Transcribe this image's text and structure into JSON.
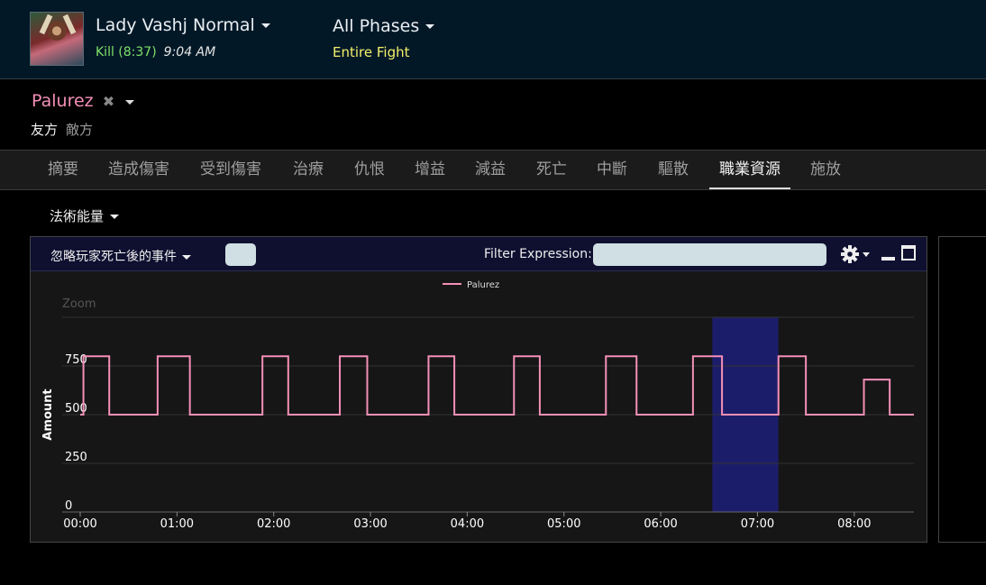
{
  "boss": {
    "name": "Lady Vashj Normal",
    "result": "Kill (8:37)",
    "time": "9:04 AM"
  },
  "phase": {
    "name": "All Phases",
    "subtitle": "Entire Fight"
  },
  "player": {
    "name": "Palurez",
    "remove_glyph": "✖",
    "ally_label": "友方",
    "enemy_label": "敵方"
  },
  "tabs": [
    {
      "label": "摘要",
      "active": false
    },
    {
      "label": "造成傷害",
      "active": false
    },
    {
      "label": "受到傷害",
      "active": false
    },
    {
      "label": "治療",
      "active": false
    },
    {
      "label": "仇恨",
      "active": false
    },
    {
      "label": "增益",
      "active": false
    },
    {
      "label": "減益",
      "active": false
    },
    {
      "label": "死亡",
      "active": false
    },
    {
      "label": "中斷",
      "active": false
    },
    {
      "label": "驅散",
      "active": false
    },
    {
      "label": "職業資源",
      "active": true
    },
    {
      "label": "施放",
      "active": false
    }
  ],
  "resource_type": "法術能量",
  "panel": {
    "ignore_label": "忽略玩家死亡後的事件",
    "filter_label": "Filter Expression:",
    "filter_value": ""
  },
  "colors": {
    "series": "#f490b7",
    "highlight": "#1c1d6a",
    "kill": "#7fe067",
    "phase_sub": "#f2ef6a"
  },
  "chart_data": {
    "type": "line",
    "step": true,
    "zoom_label": "Zoom",
    "ylabel": "Amount",
    "xlabel": "",
    "ylim": [
      0,
      1000
    ],
    "yticks": [
      0,
      250,
      500,
      750
    ],
    "xlim": [
      0,
      517
    ],
    "xticks": [
      "00:00",
      "01:00",
      "02:00",
      "03:00",
      "04:00",
      "05:00",
      "06:00",
      "07:00",
      "08:00"
    ],
    "legend": "top-center",
    "grid": true,
    "highlight_range": [
      392,
      433
    ],
    "series": [
      {
        "name": "Palurez",
        "x": [
          0,
          2,
          18,
          48,
          68,
          113,
          129,
          161,
          178,
          216,
          232,
          269,
          285,
          326,
          345,
          380,
          398,
          433,
          450,
          486,
          502,
          517
        ],
        "y": [
          500,
          800,
          500,
          800,
          500,
          800,
          500,
          800,
          500,
          800,
          500,
          800,
          500,
          800,
          500,
          800,
          500,
          800,
          500,
          680,
          500,
          500
        ]
      }
    ]
  }
}
